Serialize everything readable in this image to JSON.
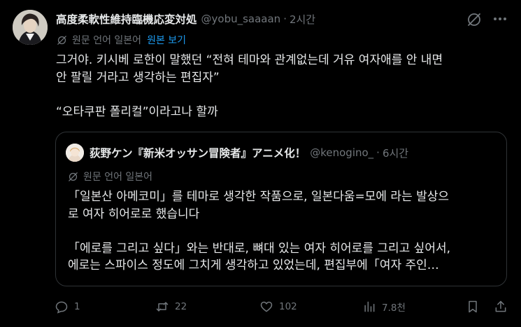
{
  "post": {
    "display_name": "高度柔軟性維持臨機応変対処",
    "handle": "@yobu_saaaan",
    "separator": "·",
    "time": "2시간",
    "translation_label": "원문 언어 일본어",
    "translation_link": "원본 보기",
    "text_lines": [
      "그거야. 키시베 로한이 말했던 “전혀 테마와 관계없는데 거유 여자애를 안 내면",
      "안 팔릴 거라고 생각하는 편집자”",
      "",
      "“오타쿠판 폴리컬”이라고나 할까"
    ]
  },
  "quote": {
    "display_name": "荻野ケン『新米オッサン冒険者』アニメ化！",
    "handle": "@kenogino_",
    "separator": "·",
    "time": "6시간",
    "translation_label": "원문 언어 일본어",
    "text_lines": [
      "「일본산 아메코미」를 테마로 생각한 작품으로, 일본다움=모에 라는 발상으",
      "로 여자 히어로로 했습니다",
      "",
      "「에로를 그리고 싶다」와는 반대로, 뼈대 있는 여자 히어로를 그리고 싶어서,",
      "에로는 스파이스 정도에 그치게 생각하고 있었는데, 편집부에「여자 주인…"
    ]
  },
  "actions": {
    "replies": "1",
    "reposts": "22",
    "likes": "102",
    "views": "7.8천"
  },
  "icons": [
    "grok-icon",
    "more-icon",
    "translate-icon",
    "reply-icon",
    "repost-icon",
    "like-icon",
    "views-icon",
    "bookmark-icon",
    "share-icon"
  ],
  "colors": {
    "background": "#000000",
    "text": "#e7e9ea",
    "muted": "#71767b",
    "link": "#1d9bf0",
    "border": "#2f3336"
  }
}
